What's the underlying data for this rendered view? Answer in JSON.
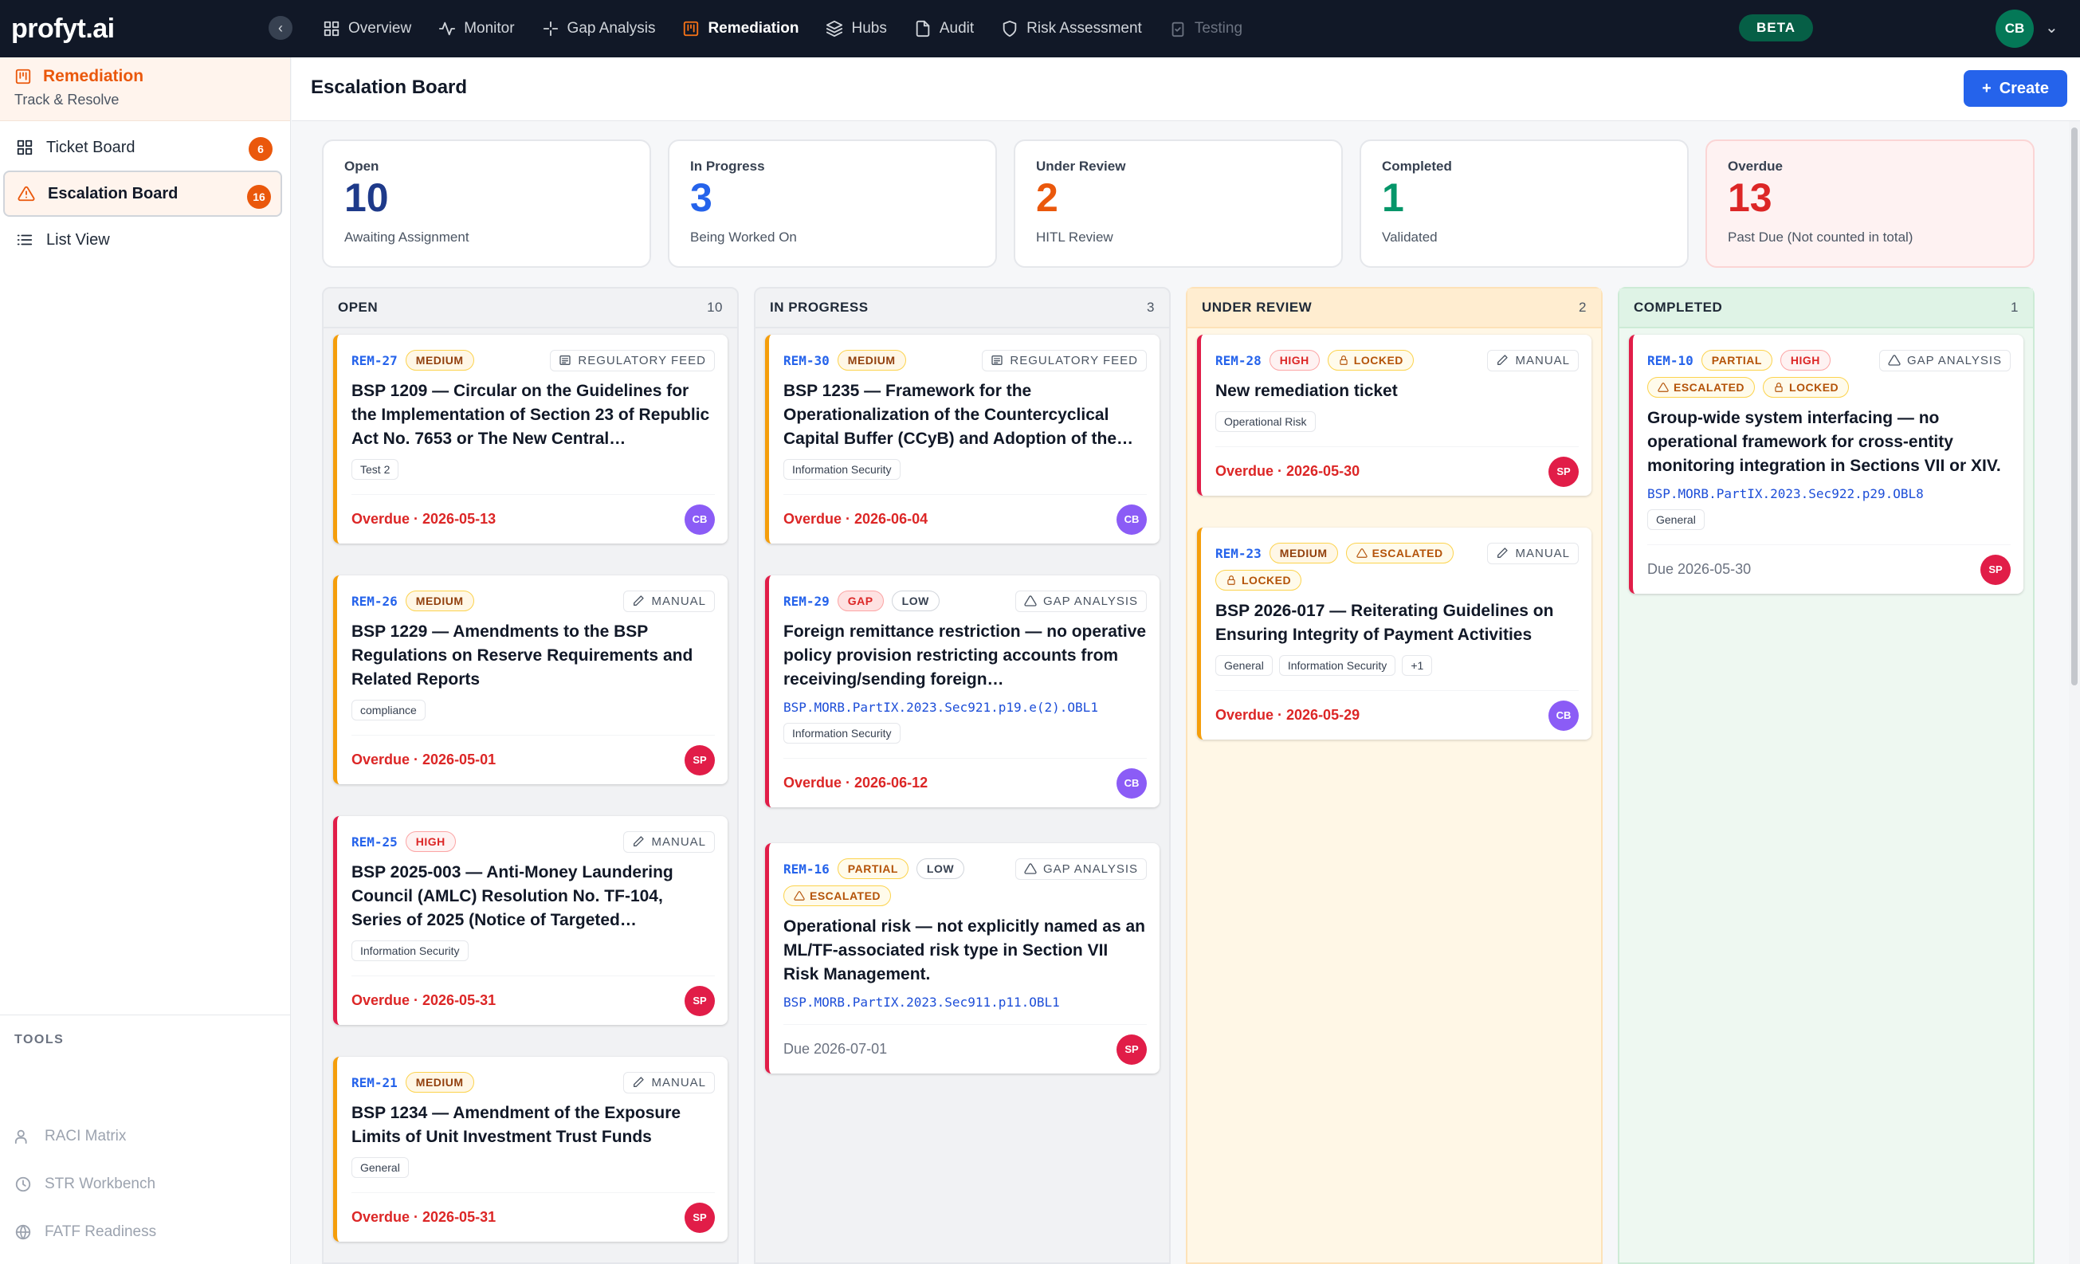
{
  "brand": {
    "logo": "profyt.ai"
  },
  "topnav": {
    "items": [
      {
        "label": "Overview"
      },
      {
        "label": "Monitor"
      },
      {
        "label": "Gap Analysis"
      },
      {
        "label": "Remediation"
      },
      {
        "label": "Hubs"
      },
      {
        "label": "Audit"
      },
      {
        "label": "Risk Assessment"
      },
      {
        "label": "Testing"
      }
    ],
    "beta": "BETA",
    "user_initials": "CB"
  },
  "sidebar": {
    "title": "Remediation",
    "subtitle": "Track & Resolve",
    "items": [
      {
        "label": "Ticket Board",
        "badge": "6"
      },
      {
        "label": "Escalation Board",
        "badge": "16"
      },
      {
        "label": "List View"
      }
    ],
    "tools_title": "TOOLS",
    "tools": [
      {
        "label": "RACI Matrix"
      },
      {
        "label": "STR Workbench"
      },
      {
        "label": "FATF Readiness"
      }
    ]
  },
  "header": {
    "title": "Escalation Board",
    "create": "Create"
  },
  "stats": [
    {
      "label": "Open",
      "value": "10",
      "sub": "Awaiting Assignment",
      "color": "#1e3a8a"
    },
    {
      "label": "In Progress",
      "value": "3",
      "sub": "Being Worked On",
      "color": "#2563eb"
    },
    {
      "label": "Under Review",
      "value": "2",
      "sub": "HITL Review",
      "color": "#ea580c"
    },
    {
      "label": "Completed",
      "value": "1",
      "sub": "Validated",
      "color": "#059669"
    },
    {
      "label": "Overdue",
      "value": "13",
      "sub": "Past Due (Not counted in total)",
      "color": "#dc2626"
    }
  ],
  "columns": [
    {
      "title": "OPEN",
      "count": "10",
      "cards": [
        {
          "ref": "REM-27",
          "tags": [
            {
              "text": "MEDIUM",
              "kind": "medium"
            }
          ],
          "source": "REGULATORY FEED",
          "title": "BSP 1209 — Circular on the Guidelines for the Implementation of Section 23 of Republic Act No. 7653 or The New Central…",
          "cats": [
            "Test 2"
          ],
          "due": "Overdue · 2026-05-13",
          "assignee": "CB"
        },
        {
          "ref": "REM-26",
          "tags": [
            {
              "text": "MEDIUM",
              "kind": "medium"
            }
          ],
          "source": "MANUAL",
          "title": "BSP 1229 — Amendments to the BSP Regulations on Reserve Requirements and Related Reports",
          "cats": [
            "compliance"
          ],
          "due": "Overdue · 2026-05-01",
          "assignee": "SP"
        },
        {
          "ref": "REM-25",
          "tags": [
            {
              "text": "HIGH",
              "kind": "high"
            }
          ],
          "source": "MANUAL",
          "title": "BSP 2025-003 — Anti-Money Laundering Council (AMLC) Resolution No. TF-104, Series of 2025 (Notice of Targeted…",
          "cats": [
            "Information Security"
          ],
          "due": "Overdue · 2026-05-31",
          "assignee": "SP"
        },
        {
          "ref": "REM-21",
          "tags": [
            {
              "text": "MEDIUM",
              "kind": "medium"
            }
          ],
          "source": "MANUAL",
          "title": "BSP 1234 — Amendment of the Exposure Limits of Unit Investment Trust Funds",
          "cats": [
            "General"
          ],
          "due": "Overdue · 2026-05-31",
          "assignee": "SP"
        }
      ]
    },
    {
      "title": "IN PROGRESS",
      "count": "3",
      "cards": [
        {
          "ref": "REM-30",
          "tags": [
            {
              "text": "MEDIUM",
              "kind": "medium"
            }
          ],
          "source": "REGULATORY FEED",
          "title": "BSP 1235 — Framework for the Operationalization of the Countercyclical Capital Buffer (CCyB) and Adoption of the…",
          "cats": [
            "Information Security"
          ],
          "due": "Overdue · 2026-06-04",
          "assignee": "CB"
        },
        {
          "ref": "REM-29",
          "tags": [
            {
              "text": "GAP",
              "kind": "gap"
            },
            {
              "text": "LOW",
              "kind": "low"
            }
          ],
          "source": "GAP ANALYSIS",
          "title": "Foreign remittance restriction — no operative policy provision restricting accounts from receiving/sending foreign…",
          "code": "BSP.MORB.PartIX.2023.Sec921.p19.e(2).OBL1",
          "cats": [
            "Information Security"
          ],
          "due": "Overdue · 2026-06-12",
          "assignee": "CB"
        },
        {
          "ref": "REM-16",
          "tags": [
            {
              "text": "PARTIAL",
              "kind": "partial"
            },
            {
              "text": "LOW",
              "kind": "low"
            }
          ],
          "source": "GAP ANALYSIS",
          "tags2": [
            {
              "text": "ESCALATED",
              "kind": "escalated"
            }
          ],
          "title": "Operational risk — not explicitly named as an ML/TF-associated risk type in Section VII Risk Management.",
          "code": "BSP.MORB.PartIX.2023.Sec911.p11.OBL1",
          "cats": [],
          "due": "Due 2026-07-01",
          "assignee": "SP"
        }
      ]
    },
    {
      "title": "UNDER REVIEW",
      "count": "2",
      "cards": [
        {
          "ref": "REM-28",
          "tags": [
            {
              "text": "HIGH",
              "kind": "high"
            },
            {
              "text": "LOCKED",
              "kind": "locked"
            }
          ],
          "source": "MANUAL",
          "title": "New remediation ticket",
          "cats": [
            "Operational Risk"
          ],
          "due": "Overdue · 2026-05-30",
          "assignee": "SP"
        },
        {
          "ref": "REM-23",
          "tags": [
            {
              "text": "MEDIUM",
              "kind": "medium"
            },
            {
              "text": "ESCALATED",
              "kind": "escalated"
            }
          ],
          "source": "MANUAL",
          "tags2": [
            {
              "text": "LOCKED",
              "kind": "locked"
            }
          ],
          "title": "BSP 2026-017 — Reiterating Guidelines on Ensuring Integrity of Payment Activities",
          "cats": [
            "General",
            "Information Security",
            "+1"
          ],
          "due": "Overdue · 2026-05-29",
          "assignee": "CB"
        }
      ]
    },
    {
      "title": "COMPLETED",
      "count": "1",
      "cards": [
        {
          "ref": "REM-10",
          "tags": [
            {
              "text": "PARTIAL",
              "kind": "partial"
            },
            {
              "text": "HIGH",
              "kind": "high"
            }
          ],
          "source": "GAP ANALYSIS",
          "tags2": [
            {
              "text": "ESCALATED",
              "kind": "escalated"
            },
            {
              "text": "LOCKED",
              "kind": "locked"
            }
          ],
          "title": "Group-wide system interfacing — no operational framework for cross-entity monitoring integration in Sections VII or XIV.",
          "code": "BSP.MORB.PartIX.2023.Sec922.p29.OBL8",
          "cats": [
            "General"
          ],
          "due": "Due 2026-05-30",
          "assignee": "SP"
        }
      ]
    }
  ]
}
